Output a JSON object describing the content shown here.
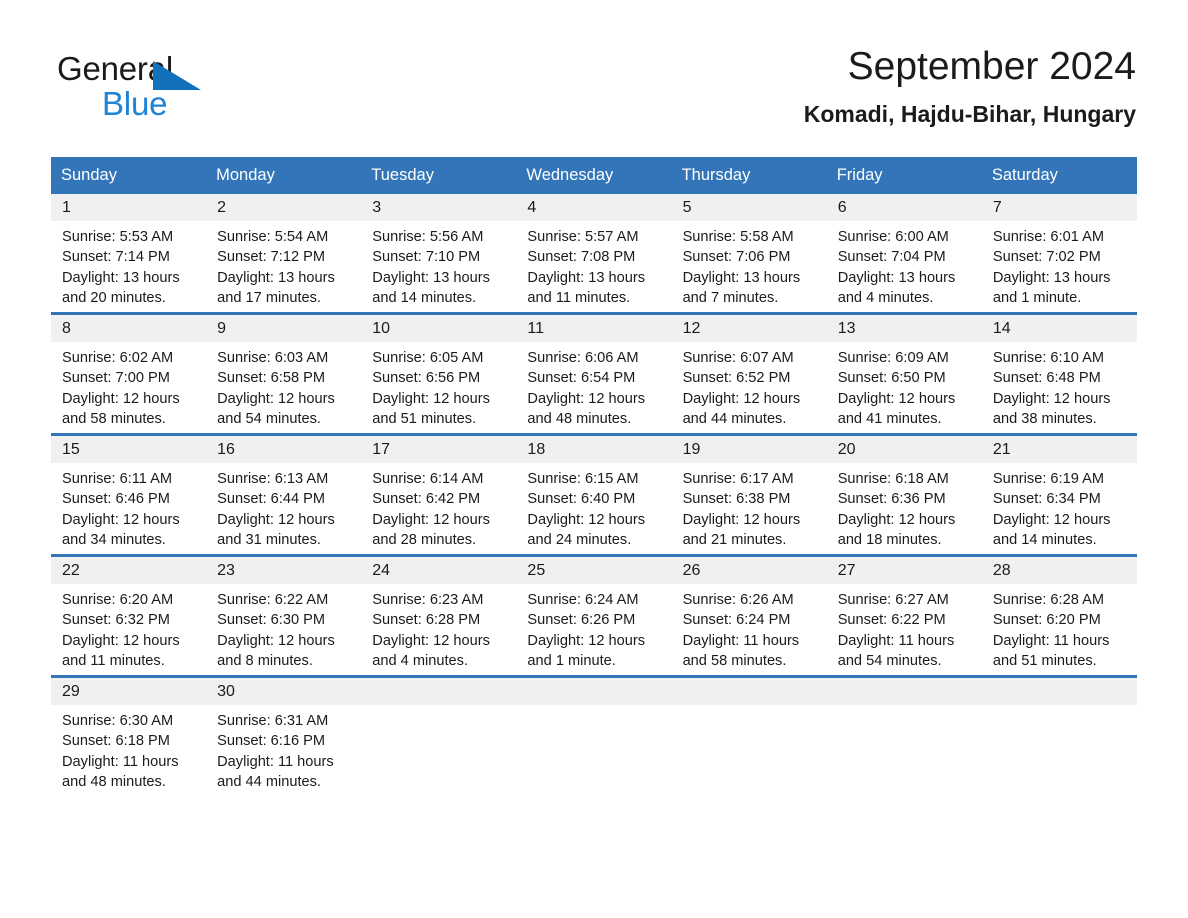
{
  "brand": {
    "line1": "General",
    "line2": "Blue",
    "triangle_color": "#1271bb",
    "blue_text_color": "#1f84d6"
  },
  "header": {
    "month_title": "September 2024",
    "location": "Komadi, Hajdu-Bihar, Hungary"
  },
  "theme": {
    "header_blue": "#3275b9",
    "daynum_band": "#f0f0f0",
    "text": "#1b1b1b",
    "page_background": "#ffffff"
  },
  "weekday_headers": [
    "Sunday",
    "Monday",
    "Tuesday",
    "Wednesday",
    "Thursday",
    "Friday",
    "Saturday"
  ],
  "weeks": [
    [
      {
        "day": "1",
        "sunrise": "Sunrise: 5:53 AM",
        "sunset": "Sunset: 7:14 PM",
        "daylight_line1": "Daylight: 13 hours",
        "daylight_line2": "and 20 minutes."
      },
      {
        "day": "2",
        "sunrise": "Sunrise: 5:54 AM",
        "sunset": "Sunset: 7:12 PM",
        "daylight_line1": "Daylight: 13 hours",
        "daylight_line2": "and 17 minutes."
      },
      {
        "day": "3",
        "sunrise": "Sunrise: 5:56 AM",
        "sunset": "Sunset: 7:10 PM",
        "daylight_line1": "Daylight: 13 hours",
        "daylight_line2": "and 14 minutes."
      },
      {
        "day": "4",
        "sunrise": "Sunrise: 5:57 AM",
        "sunset": "Sunset: 7:08 PM",
        "daylight_line1": "Daylight: 13 hours",
        "daylight_line2": "and 11 minutes."
      },
      {
        "day": "5",
        "sunrise": "Sunrise: 5:58 AM",
        "sunset": "Sunset: 7:06 PM",
        "daylight_line1": "Daylight: 13 hours",
        "daylight_line2": "and 7 minutes."
      },
      {
        "day": "6",
        "sunrise": "Sunrise: 6:00 AM",
        "sunset": "Sunset: 7:04 PM",
        "daylight_line1": "Daylight: 13 hours",
        "daylight_line2": "and 4 minutes."
      },
      {
        "day": "7",
        "sunrise": "Sunrise: 6:01 AM",
        "sunset": "Sunset: 7:02 PM",
        "daylight_line1": "Daylight: 13 hours",
        "daylight_line2": "and 1 minute."
      }
    ],
    [
      {
        "day": "8",
        "sunrise": "Sunrise: 6:02 AM",
        "sunset": "Sunset: 7:00 PM",
        "daylight_line1": "Daylight: 12 hours",
        "daylight_line2": "and 58 minutes."
      },
      {
        "day": "9",
        "sunrise": "Sunrise: 6:03 AM",
        "sunset": "Sunset: 6:58 PM",
        "daylight_line1": "Daylight: 12 hours",
        "daylight_line2": "and 54 minutes."
      },
      {
        "day": "10",
        "sunrise": "Sunrise: 6:05 AM",
        "sunset": "Sunset: 6:56 PM",
        "daylight_line1": "Daylight: 12 hours",
        "daylight_line2": "and 51 minutes."
      },
      {
        "day": "11",
        "sunrise": "Sunrise: 6:06 AM",
        "sunset": "Sunset: 6:54 PM",
        "daylight_line1": "Daylight: 12 hours",
        "daylight_line2": "and 48 minutes."
      },
      {
        "day": "12",
        "sunrise": "Sunrise: 6:07 AM",
        "sunset": "Sunset: 6:52 PM",
        "daylight_line1": "Daylight: 12 hours",
        "daylight_line2": "and 44 minutes."
      },
      {
        "day": "13",
        "sunrise": "Sunrise: 6:09 AM",
        "sunset": "Sunset: 6:50 PM",
        "daylight_line1": "Daylight: 12 hours",
        "daylight_line2": "and 41 minutes."
      },
      {
        "day": "14",
        "sunrise": "Sunrise: 6:10 AM",
        "sunset": "Sunset: 6:48 PM",
        "daylight_line1": "Daylight: 12 hours",
        "daylight_line2": "and 38 minutes."
      }
    ],
    [
      {
        "day": "15",
        "sunrise": "Sunrise: 6:11 AM",
        "sunset": "Sunset: 6:46 PM",
        "daylight_line1": "Daylight: 12 hours",
        "daylight_line2": "and 34 minutes."
      },
      {
        "day": "16",
        "sunrise": "Sunrise: 6:13 AM",
        "sunset": "Sunset: 6:44 PM",
        "daylight_line1": "Daylight: 12 hours",
        "daylight_line2": "and 31 minutes."
      },
      {
        "day": "17",
        "sunrise": "Sunrise: 6:14 AM",
        "sunset": "Sunset: 6:42 PM",
        "daylight_line1": "Daylight: 12 hours",
        "daylight_line2": "and 28 minutes."
      },
      {
        "day": "18",
        "sunrise": "Sunrise: 6:15 AM",
        "sunset": "Sunset: 6:40 PM",
        "daylight_line1": "Daylight: 12 hours",
        "daylight_line2": "and 24 minutes."
      },
      {
        "day": "19",
        "sunrise": "Sunrise: 6:17 AM",
        "sunset": "Sunset: 6:38 PM",
        "daylight_line1": "Daylight: 12 hours",
        "daylight_line2": "and 21 minutes."
      },
      {
        "day": "20",
        "sunrise": "Sunrise: 6:18 AM",
        "sunset": "Sunset: 6:36 PM",
        "daylight_line1": "Daylight: 12 hours",
        "daylight_line2": "and 18 minutes."
      },
      {
        "day": "21",
        "sunrise": "Sunrise: 6:19 AM",
        "sunset": "Sunset: 6:34 PM",
        "daylight_line1": "Daylight: 12 hours",
        "daylight_line2": "and 14 minutes."
      }
    ],
    [
      {
        "day": "22",
        "sunrise": "Sunrise: 6:20 AM",
        "sunset": "Sunset: 6:32 PM",
        "daylight_line1": "Daylight: 12 hours",
        "daylight_line2": "and 11 minutes."
      },
      {
        "day": "23",
        "sunrise": "Sunrise: 6:22 AM",
        "sunset": "Sunset: 6:30 PM",
        "daylight_line1": "Daylight: 12 hours",
        "daylight_line2": "and 8 minutes."
      },
      {
        "day": "24",
        "sunrise": "Sunrise: 6:23 AM",
        "sunset": "Sunset: 6:28 PM",
        "daylight_line1": "Daylight: 12 hours",
        "daylight_line2": "and 4 minutes."
      },
      {
        "day": "25",
        "sunrise": "Sunrise: 6:24 AM",
        "sunset": "Sunset: 6:26 PM",
        "daylight_line1": "Daylight: 12 hours",
        "daylight_line2": "and 1 minute."
      },
      {
        "day": "26",
        "sunrise": "Sunrise: 6:26 AM",
        "sunset": "Sunset: 6:24 PM",
        "daylight_line1": "Daylight: 11 hours",
        "daylight_line2": "and 58 minutes."
      },
      {
        "day": "27",
        "sunrise": "Sunrise: 6:27 AM",
        "sunset": "Sunset: 6:22 PM",
        "daylight_line1": "Daylight: 11 hours",
        "daylight_line2": "and 54 minutes."
      },
      {
        "day": "28",
        "sunrise": "Sunrise: 6:28 AM",
        "sunset": "Sunset: 6:20 PM",
        "daylight_line1": "Daylight: 11 hours",
        "daylight_line2": "and 51 minutes."
      }
    ],
    [
      {
        "day": "29",
        "sunrise": "Sunrise: 6:30 AM",
        "sunset": "Sunset: 6:18 PM",
        "daylight_line1": "Daylight: 11 hours",
        "daylight_line2": "and 48 minutes."
      },
      {
        "day": "30",
        "sunrise": "Sunrise: 6:31 AM",
        "sunset": "Sunset: 6:16 PM",
        "daylight_line1": "Daylight: 11 hours",
        "daylight_line2": "and 44 minutes."
      },
      {
        "day": "",
        "sunrise": "",
        "sunset": "",
        "daylight_line1": "",
        "daylight_line2": ""
      },
      {
        "day": "",
        "sunrise": "",
        "sunset": "",
        "daylight_line1": "",
        "daylight_line2": ""
      },
      {
        "day": "",
        "sunrise": "",
        "sunset": "",
        "daylight_line1": "",
        "daylight_line2": ""
      },
      {
        "day": "",
        "sunrise": "",
        "sunset": "",
        "daylight_line1": "",
        "daylight_line2": ""
      },
      {
        "day": "",
        "sunrise": "",
        "sunset": "",
        "daylight_line1": "",
        "daylight_line2": ""
      }
    ]
  ]
}
